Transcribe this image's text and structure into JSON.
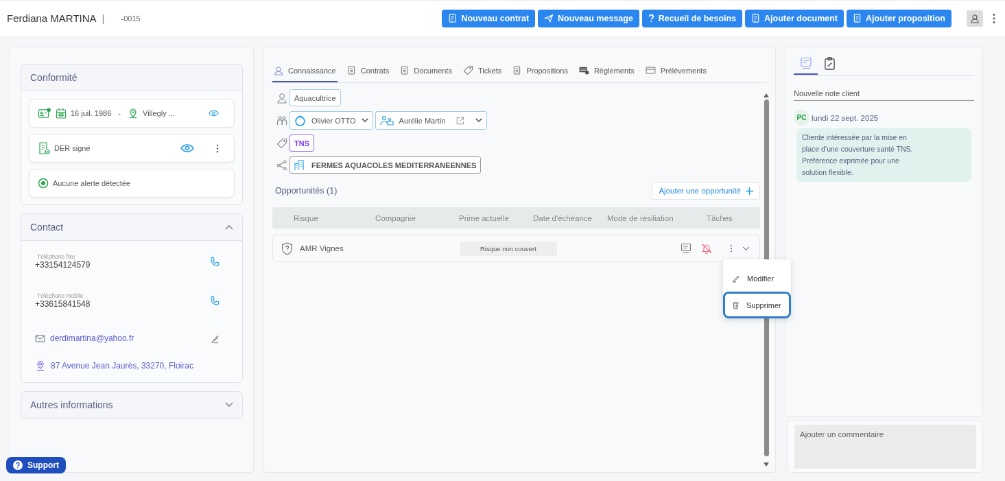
{
  "header": {
    "name": "Ferdiana MARTINA",
    "separator": "|",
    "reference": "-0015",
    "actions": [
      {
        "label": "Nouveau contrat"
      },
      {
        "label": "Nouveau message"
      },
      {
        "label": "Recueil de besoins"
      },
      {
        "label": "Ajouter document"
      },
      {
        "label": "Ajouter proposition"
      }
    ]
  },
  "compliance": {
    "title": "Conformité",
    "birth_date": "16 juil. 1986",
    "dash": "-",
    "birth_place": "Villegly ...",
    "der": "DER signé",
    "alert": "Aucune alerte détectée"
  },
  "contact": {
    "title": "Contact",
    "expanded": true,
    "phones": [
      {
        "label": "Téléphone fixe",
        "number": "+33154124579"
      },
      {
        "label": "Téléphone mobile",
        "number": "+33615841548"
      }
    ],
    "email": "derdimartina@yahoo.fr",
    "address": "87 Avenue Jean Jaurès, 33270, Floirac"
  },
  "other_info": {
    "title": "Autres informations",
    "expanded": false
  },
  "tabs": [
    {
      "label": "Connaissance",
      "selected": true
    },
    {
      "label": "Contrats",
      "selected": false
    },
    {
      "label": "Documents",
      "selected": false
    },
    {
      "label": "Tickets",
      "selected": false
    },
    {
      "label": "Propositions",
      "selected": false
    },
    {
      "label": "Règlements",
      "selected": false
    },
    {
      "label": "Prélèvements",
      "selected": false
    }
  ],
  "profile": {
    "profession": "Aquacultrice",
    "advisor": "Olivier OTTO",
    "contact_person": "Aurélie Martin",
    "tag": "TNS",
    "company": "FERMES AQUACOLES MEDITERRANEENNES"
  },
  "opportunities": {
    "title": "Opportunités (1)",
    "add_button": "Ajouter une opportunité",
    "columns": [
      "Risque",
      "Compagnie",
      "Prime actuelle",
      "Date d'échéance",
      "Mode de résiliation",
      "Tâches"
    ],
    "rows": [
      {
        "risk": "AMR Vignes",
        "status": "Risque non couvert"
      }
    ]
  },
  "row_menu": {
    "items": [
      {
        "label": "Modifier",
        "selected": false
      },
      {
        "label": "Supprimer",
        "selected": true
      }
    ]
  },
  "notes": {
    "tabs": [
      {
        "selected": true
      },
      {
        "selected": false
      }
    ],
    "new_note_placeholder": "Nouvelle note client",
    "entries": [
      {
        "initials": "PC",
        "date": "lundi 22 sept. 2025",
        "text": "Cliente intéressée par la mise en\nplace d’une couverture santé TNS.\nPréférence exprimée pour une\nsolution flexible."
      }
    ]
  },
  "comment": {
    "placeholder": "Ajouter un commentaire"
  },
  "support": {
    "label": "Support"
  }
}
